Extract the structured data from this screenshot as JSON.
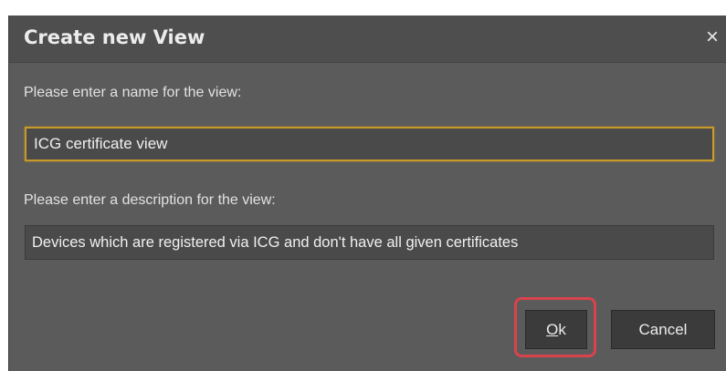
{
  "dialog": {
    "title": "Create new View",
    "close_label": "×"
  },
  "name_field": {
    "label": "Please enter a name for the view:",
    "value": "ICG certificate view"
  },
  "description_field": {
    "label": "Please enter a description for the view:",
    "value": "Devices which are registered via ICG and don't have all given certificates"
  },
  "buttons": {
    "ok_mnemonic": "O",
    "ok_rest": "k",
    "cancel_label": "Cancel"
  },
  "colors": {
    "dialog_background": "#5b5b5b",
    "title_bar": "#4e4e4e",
    "focus_border": "#c99a2a",
    "highlight_border": "#d9434b"
  }
}
